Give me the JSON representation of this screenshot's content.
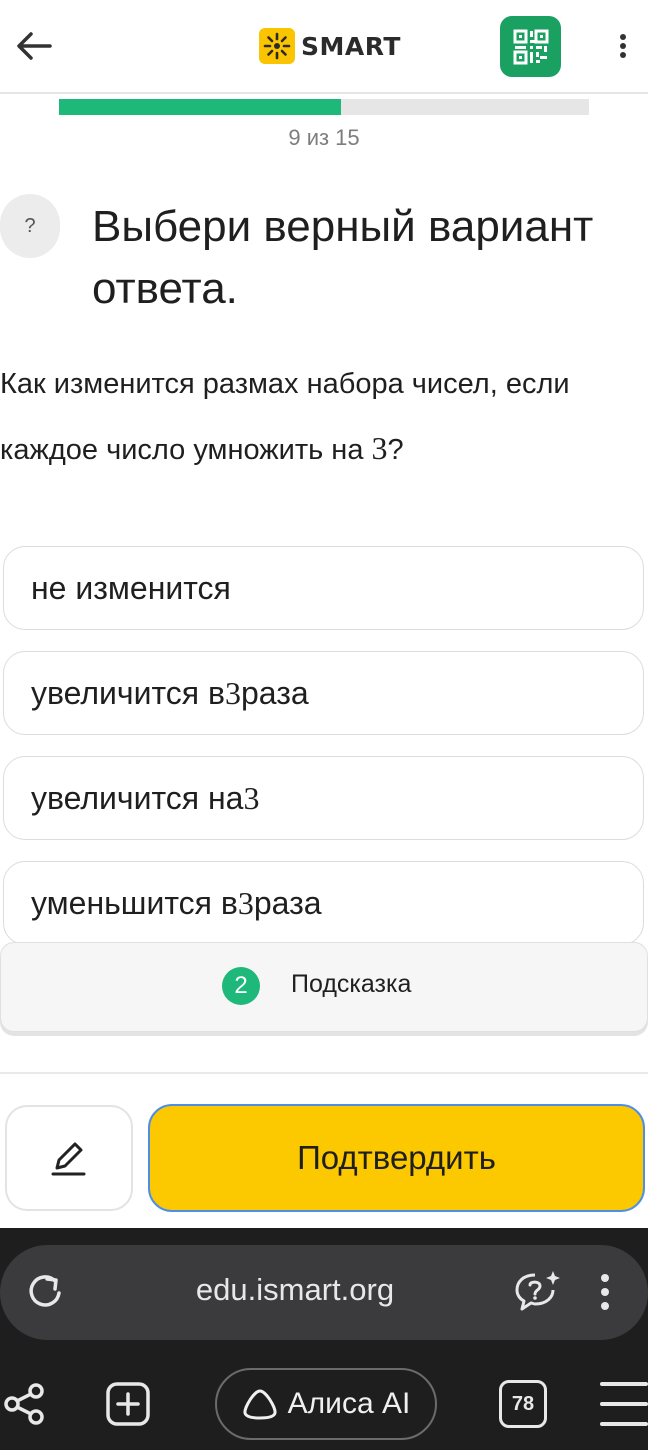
{
  "header": {
    "brand": "SMART",
    "icons": {
      "back": "arrow-left-icon",
      "qr": "qr-code-icon",
      "menu": "vertical-dots-icon"
    }
  },
  "progress": {
    "current": 9,
    "total": 15,
    "text": "9 из 15",
    "fraction": 0.533,
    "fill_color": "#1db87a"
  },
  "task": {
    "help_label": "?",
    "title": "Выбери верный вариант ответа.",
    "question_before": "Как изменится размах набора чисел, если каждое число умножить на ",
    "question_number": "3",
    "question_after": "?"
  },
  "answers": [
    {
      "before": "не изменится",
      "number": "",
      "after": ""
    },
    {
      "before": "увеличится в ",
      "number": "3",
      "after": " раза"
    },
    {
      "before": "увеличится на ",
      "number": "3",
      "after": ""
    },
    {
      "before": "уменьшится в ",
      "number": "3",
      "after": " раза"
    }
  ],
  "hint": {
    "count": "2",
    "label": "Подсказка"
  },
  "actions": {
    "confirm_label": "Подтвердить",
    "confirm_color": "#fcc800"
  },
  "browser": {
    "url": "edu.ismart.org",
    "alice_label": "Алиса AI",
    "tab_count": "78"
  }
}
